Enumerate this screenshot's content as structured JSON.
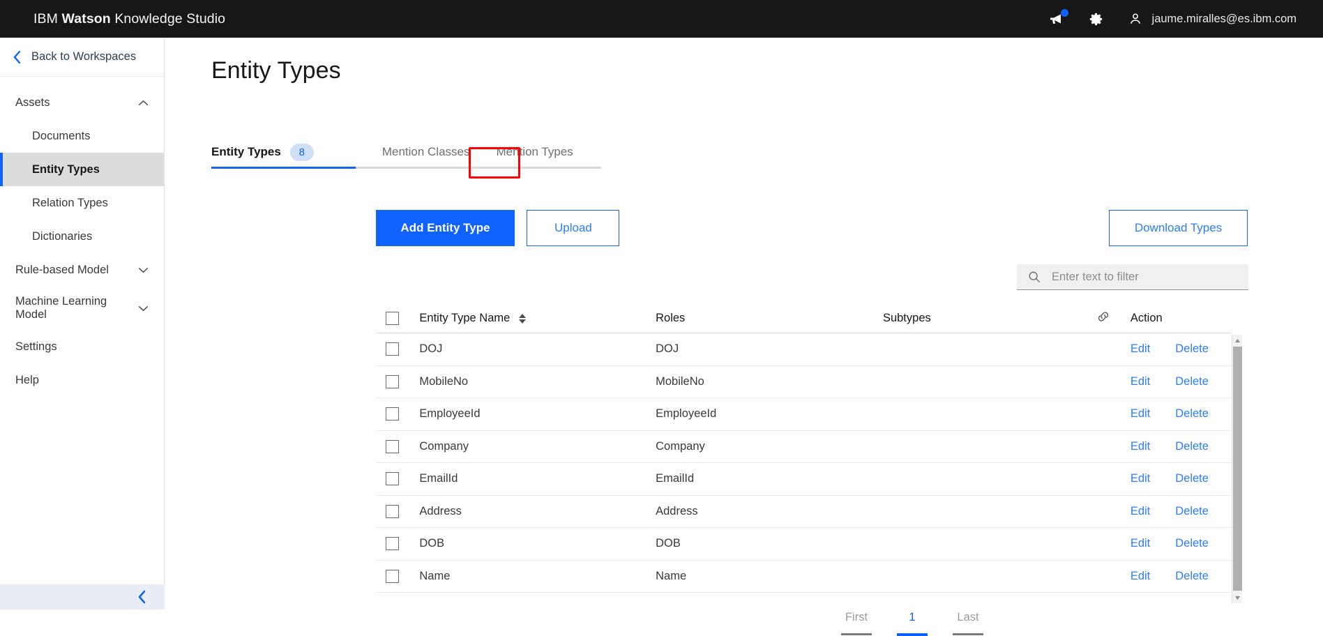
{
  "header": {
    "brand_prefix": "IBM ",
    "brand_bold": "Watson",
    "brand_suffix": " Knowledge Studio",
    "announcement_icon": "megaphone-icon",
    "settings_icon": "gear-icon",
    "user_icon": "user-avatar-icon",
    "user_email": "jaume.miralles@es.ibm.com"
  },
  "sidebar": {
    "back_label": "Back to Workspaces",
    "back_icon": "chevron-left-icon",
    "groups": [
      {
        "label": "Assets",
        "icon": "chevron-up-icon"
      }
    ],
    "asset_items": [
      {
        "label": "Documents",
        "active": false
      },
      {
        "label": "Entity Types",
        "active": true
      },
      {
        "label": "Relation Types",
        "active": false
      },
      {
        "label": "Dictionaries",
        "active": false
      }
    ],
    "model_groups": [
      {
        "label": "Rule-based Model",
        "icon": "chevron-down-icon"
      },
      {
        "label": "Machine Learning Model",
        "icon": "chevron-down-icon"
      }
    ],
    "plain_items": [
      {
        "label": "Settings"
      },
      {
        "label": "Help"
      }
    ],
    "collapse_icon": "chevron-left-icon"
  },
  "main": {
    "page_title": "Entity Types",
    "tabs": [
      {
        "label": "Entity Types",
        "badge": "8",
        "active": true
      },
      {
        "label": "Mention Classes",
        "badge": "",
        "active": false
      },
      {
        "label": "Mention Types",
        "badge": "",
        "active": false
      }
    ],
    "buttons": {
      "add_entity_type": "Add Entity Type",
      "upload": "Upload",
      "download_types": "Download Types"
    },
    "filter": {
      "placeholder": "Enter text to filter",
      "value": "",
      "icon": "search-icon"
    },
    "table": {
      "columns": {
        "name": "Entity Type Name",
        "roles": "Roles",
        "subtypes": "Subtypes",
        "link_icon": "link-icon",
        "action": "Action"
      },
      "sort_icon": "sort-arrows-icon",
      "rows": [
        {
          "name": "DOJ",
          "roles": "DOJ",
          "subtypes": "",
          "edit": "Edit",
          "delete": "Delete"
        },
        {
          "name": "MobileNo",
          "roles": "MobileNo",
          "subtypes": "",
          "edit": "Edit",
          "delete": "Delete"
        },
        {
          "name": "EmployeeId",
          "roles": "EmployeeId",
          "subtypes": "",
          "edit": "Edit",
          "delete": "Delete"
        },
        {
          "name": "Company",
          "roles": "Company",
          "subtypes": "",
          "edit": "Edit",
          "delete": "Delete"
        },
        {
          "name": "EmailId",
          "roles": "EmailId",
          "subtypes": "",
          "edit": "Edit",
          "delete": "Delete"
        },
        {
          "name": "Address",
          "roles": "Address",
          "subtypes": "",
          "edit": "Edit",
          "delete": "Delete"
        },
        {
          "name": "DOB",
          "roles": "DOB",
          "subtypes": "",
          "edit": "Edit",
          "delete": "Delete"
        },
        {
          "name": "Name",
          "roles": "Name",
          "subtypes": "",
          "edit": "Edit",
          "delete": "Delete"
        }
      ]
    },
    "pagination": [
      {
        "label": "First",
        "current": false
      },
      {
        "label": "1",
        "current": true
      },
      {
        "label": "Last",
        "current": false
      }
    ]
  },
  "annotation": {
    "type": "red-rectangle-highlight",
    "target": "entity-types-tab-badge",
    "color": "#ff0000"
  },
  "colors": {
    "brand_blue": "#0f62fe",
    "link_blue": "#2b7ef7",
    "header_black": "#171717",
    "badge_bg": "#cfdff8",
    "active_nav_bg": "#dcdcdc"
  }
}
